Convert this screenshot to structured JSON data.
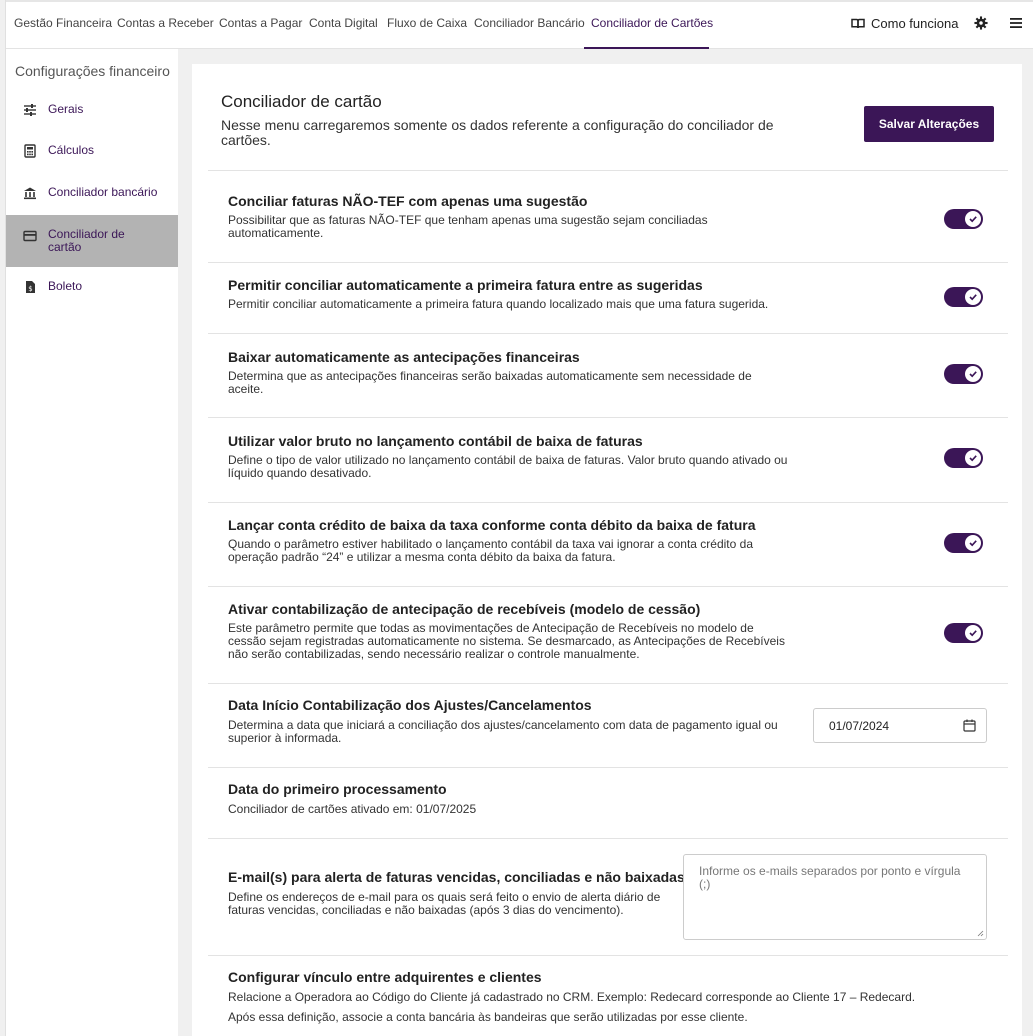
{
  "nav": {
    "tabs": [
      {
        "label": "Gestão Financeira"
      },
      {
        "label": "Contas a Receber"
      },
      {
        "label": "Contas a Pagar"
      },
      {
        "label": "Conta Digital"
      },
      {
        "label": "Fluxo de Caixa"
      },
      {
        "label": "Conciliador Bancário"
      },
      {
        "label": "Conciliador de Cartões"
      }
    ],
    "active_tab": "Conciliador de Cartões",
    "howto_label": "Como funciona",
    "icons": [
      "book-icon",
      "gear-icon",
      "menu-icon"
    ]
  },
  "sidebar": {
    "title": "Configurações financeiro",
    "items": [
      {
        "label": "Gerais",
        "icon": "sliders-icon"
      },
      {
        "label": "Cálculos",
        "icon": "calculator-icon"
      },
      {
        "label": "Conciliador bancário",
        "icon": "bank-icon"
      },
      {
        "label": "Conciliador de cartão",
        "icon": "card-icon"
      },
      {
        "label": "Boleto",
        "icon": "boleto-icon"
      }
    ],
    "active_item": "Conciliador de cartão"
  },
  "main": {
    "title": "Conciliador de cartão",
    "subtitle": "Nesse menu carregaremos somente os dados referente a configuração do conciliador de cartões.",
    "save_label": "Salvar Alterações",
    "settings": [
      {
        "title": "Conciliar faturas NÃO-TEF com apenas uma sugestão",
        "desc": "Possibilitar que as faturas NÃO-TEF que tenham apenas uma sugestão sejam conciliadas automaticamente.",
        "enabled": true
      },
      {
        "title": "Permitir conciliar automaticamente a primeira fatura entre as sugeridas",
        "desc": "Permitir conciliar automaticamente a primeira fatura quando localizado mais que uma fatura sugerida.",
        "enabled": true
      },
      {
        "title": "Baixar automaticamente as antecipações financeiras",
        "desc": "Determina que as antecipações financeiras serão baixadas automaticamente sem necessidade de aceite.",
        "enabled": true
      },
      {
        "title": "Utilizar valor bruto no lançamento contábil de baixa de faturas",
        "desc": "Define o tipo de valor utilizado no lançamento contábil de baixa de faturas. Valor bruto quando ativado ou líquido quando desativado.",
        "enabled": true
      },
      {
        "title": "Lançar conta crédito de baixa da taxa conforme conta débito da baixa de fatura",
        "desc": "Quando o parâmetro estiver habilitado o lançamento contábil da taxa vai ignorar a conta crédito da operação padrão “24” e utilizar a mesma conta débito da baixa da fatura.",
        "enabled": true
      },
      {
        "title": "Ativar contabilização de antecipação de recebíveis (modelo de cessão)",
        "desc": "Este parâmetro permite que todas as movimentações de Antecipação de Recebíveis no modelo de cessão sejam registradas automaticamente no sistema. Se desmarcado, as Antecipações de Recebíveis não serão contabilizadas, sendo necessário realizar o controle manualmente.",
        "enabled": true
      }
    ],
    "date_setting": {
      "title": "Data Início Contabilização dos Ajustes/Cancelamentos",
      "desc": "Determina a data que iniciará a conciliação dos ajustes/cancelamento com data de pagamento igual ou superior à informada.",
      "value": "01/07/2024"
    },
    "first_processing": {
      "title": "Data do primeiro processamento",
      "desc": "Conciliador de cartões ativado em: 01/07/2025"
    },
    "email_setting": {
      "title": "E-mail(s) para alerta de faturas vencidas, conciliadas e não baixadas",
      "desc": "Define os endereços de e-mail para os quais será feito o envio de alerta diário de faturas vencidas, conciliadas e não baixadas (após 3 dias do vencimento).",
      "placeholder": "Informe os e-mails separados por ponto e vírgula (;)"
    },
    "acquirers": {
      "title": "Configurar vínculo entre adquirentes e clientes",
      "desc1": "Relacione a Operadora ao Código do Cliente já cadastrado no CRM. Exemplo: Redecard corresponde ao Cliente 17 – Redecard.",
      "desc2": "Após essa definição, associe a conta bancária às bandeiras que serão utilizadas por esse cliente."
    }
  }
}
